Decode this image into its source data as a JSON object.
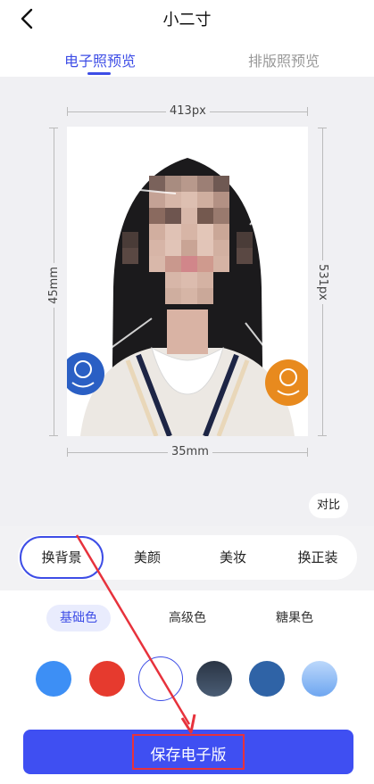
{
  "header": {
    "title": "小二寸",
    "back_icon": "chevron-left-icon"
  },
  "tabs": [
    {
      "label": "电子照预览",
      "active": true
    },
    {
      "label": "排版照预览",
      "active": false
    }
  ],
  "preview": {
    "width_px_label": "413px",
    "height_mm_label": "45mm",
    "height_px_label": "531px",
    "width_mm_label": "35mm"
  },
  "compare_label": "对比",
  "features": [
    {
      "label": "换背景",
      "active": true
    },
    {
      "label": "美颜",
      "active": false
    },
    {
      "label": "美妆",
      "active": false
    },
    {
      "label": "换正装",
      "active": false
    }
  ],
  "color_categories": [
    {
      "label": "基础色",
      "active": true
    },
    {
      "label": "高级色",
      "active": false
    },
    {
      "label": "糖果色",
      "active": false
    }
  ],
  "colors": [
    {
      "hex": "#3d8ff5",
      "selected": false
    },
    {
      "hex": "#e63a2e",
      "selected": false
    },
    {
      "hex": "#ffffff",
      "selected": true
    },
    {
      "hex": "#3a4a5e",
      "selected": false
    },
    {
      "hex": "#2f63a6",
      "selected": false
    },
    {
      "hex": "#8fbcf5",
      "selected": false
    }
  ],
  "save_label": "保存电子版",
  "accent": "#3d4de6",
  "annotation_color": "#e7323c"
}
